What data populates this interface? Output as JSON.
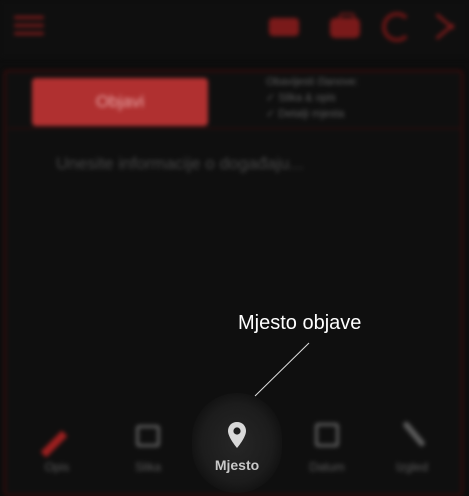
{
  "app": {
    "publish_button": "Objavi",
    "notify": {
      "title": "Obavijesti članove:",
      "options": [
        "Slika & opis",
        "Detalji mjesta"
      ]
    },
    "event_placeholder": "Unesite informacije o događaju..."
  },
  "bottom_nav": {
    "items": [
      {
        "label": "Opis",
        "icon": "pencil-icon"
      },
      {
        "label": "Slika",
        "icon": "image-icon"
      },
      {
        "label": "Mjesto",
        "icon": "pin-icon"
      },
      {
        "label": "Datum",
        "icon": "calendar-icon"
      },
      {
        "label": "Izgled",
        "icon": "wrench-icon"
      }
    ],
    "active": "Mjesto"
  },
  "annotation": {
    "text": "Mjesto objave"
  },
  "colors": {
    "accent": "#b03030",
    "background": "#0d0d0d",
    "annotation_text": "#ffffff"
  }
}
